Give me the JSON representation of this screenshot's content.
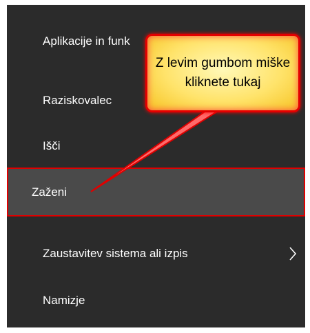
{
  "menu": {
    "items": [
      {
        "label": "Aplikacije in funk"
      },
      {
        "label": "Raziskovalec"
      },
      {
        "label": "Išči"
      },
      {
        "label": "Zaženi"
      },
      {
        "label": "Zaustavitev sistema ali izpis"
      },
      {
        "label": "Namizje"
      }
    ]
  },
  "callout": {
    "text": "Z levim gumbom miške kliknete tukaj"
  },
  "colors": {
    "menu_bg": "#2b2b2b",
    "highlight_bg": "#4a4a4a",
    "annotation_red": "#e00000",
    "callout_yellow": "#ffe36a"
  }
}
